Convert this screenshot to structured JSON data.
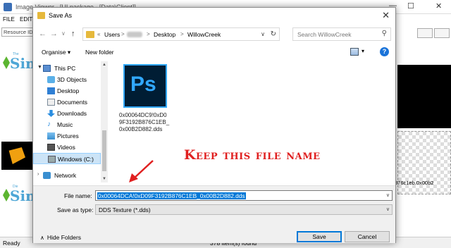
{
  "background_app": {
    "title": "Image Viewer - [UI.package - [Data\\Client]]",
    "menu": [
      "FILE",
      "EDIT"
    ],
    "resource_id_label": "Resource ID",
    "sims_logo_small": "The",
    "sims_logo_small_2": "Die",
    "sims_logo_word": "Sim",
    "right_buttons": [
      "",
      ""
    ],
    "right_partial_text": "876c1eb.0x00b2",
    "status_left": "Ready",
    "status_mid": "378 item(s) found",
    "window_controls": [
      "—",
      "☐",
      "✕"
    ]
  },
  "dialog": {
    "title": "Save As",
    "close": "✕",
    "nav": {
      "back": "←",
      "forward": "→",
      "recent": "∨",
      "up": "↑"
    },
    "breadcrumb": {
      "overflow": "«",
      "items": [
        "Users",
        "Desktop",
        "WillowCreek"
      ],
      "sep": ">"
    },
    "address_dropdown": "∨",
    "refresh": "↻",
    "search_placeholder": "Search WillowCreek",
    "search_icon": "⚲",
    "toolbar": {
      "organize": "Organise ▾",
      "new_folder": "New folder",
      "view_dropdown": "▾",
      "help": "?"
    },
    "nav_pane": [
      {
        "label": "This PC",
        "icon": "computer-icon",
        "level": 0,
        "expanded": true
      },
      {
        "label": "3D Objects",
        "icon": "3d-objects-icon",
        "level": 1
      },
      {
        "label": "Desktop",
        "icon": "desktop-icon",
        "level": 1
      },
      {
        "label": "Documents",
        "icon": "documents-icon",
        "level": 1
      },
      {
        "label": "Downloads",
        "icon": "downloads-icon",
        "level": 1
      },
      {
        "label": "Music",
        "icon": "music-icon",
        "level": 1
      },
      {
        "label": "Pictures",
        "icon": "pictures-icon",
        "level": 1
      },
      {
        "label": "Videos",
        "icon": "videos-icon",
        "level": 1
      },
      {
        "label": "Windows (C:)",
        "icon": "drive-icon",
        "level": 1,
        "selected": true
      },
      {
        "label": "Network",
        "icon": "network-icon",
        "level": 0
      }
    ],
    "files": [
      {
        "name": "0x00064DC9!0xD09F3192B876C1EB_0x00B2D882.dds",
        "icon_text": "Ps"
      }
    ],
    "annotation": "Keep this file name",
    "file_name_label": "File name:",
    "file_name_value": "0x00064DCA!0xD09F3192B876C1EB_0x00B2D882.dds",
    "save_type_label": "Save as type:",
    "save_type_value": "DDS Texture (*.dds)",
    "hide_folders": "Hide Folders",
    "save_button": "Save",
    "cancel_button": "Cancel",
    "colors": {
      "accent": "#0078d7",
      "annotation": "#e02020",
      "ps_blue": "#31a8ff",
      "ps_bg": "#001d34"
    }
  }
}
